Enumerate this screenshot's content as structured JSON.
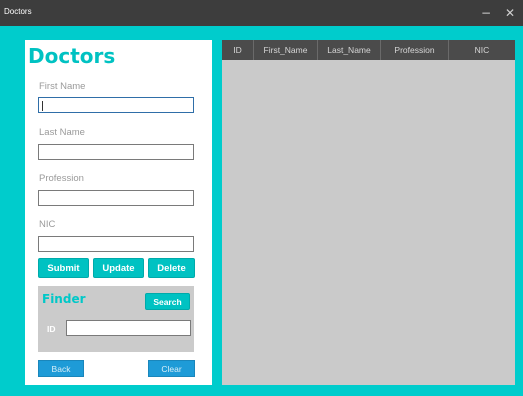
{
  "window": {
    "title": "Doctors",
    "minimize_glyph": "−",
    "close_glyph": "✕"
  },
  "form": {
    "heading": "Doctors",
    "first_name_label": "First Name",
    "first_name_value": "",
    "last_name_label": "Last Name",
    "last_name_value": "",
    "profession_label": "Profession",
    "profession_value": "",
    "nic_label": "NIC",
    "nic_value": "",
    "submit_label": "Submit",
    "update_label": "Update",
    "delete_label": "Delete"
  },
  "finder": {
    "title": "Finder",
    "search_label": "Search",
    "id_label": "ID",
    "id_value": ""
  },
  "footer": {
    "back_label": "Back",
    "clear_label": "Clear"
  },
  "table": {
    "columns": [
      "ID",
      "First_Name",
      "Last_Name",
      "Profession",
      "NIC"
    ],
    "rows": []
  },
  "colors": {
    "accent": "#00c2c2",
    "window_bg": "#00cccc",
    "titlebar": "#3d3d3d",
    "header_dark": "#4b4b4b",
    "table_bg": "#cacaca",
    "finder_bg": "#cbcbcb",
    "footer_button": "#1e9bd7"
  }
}
